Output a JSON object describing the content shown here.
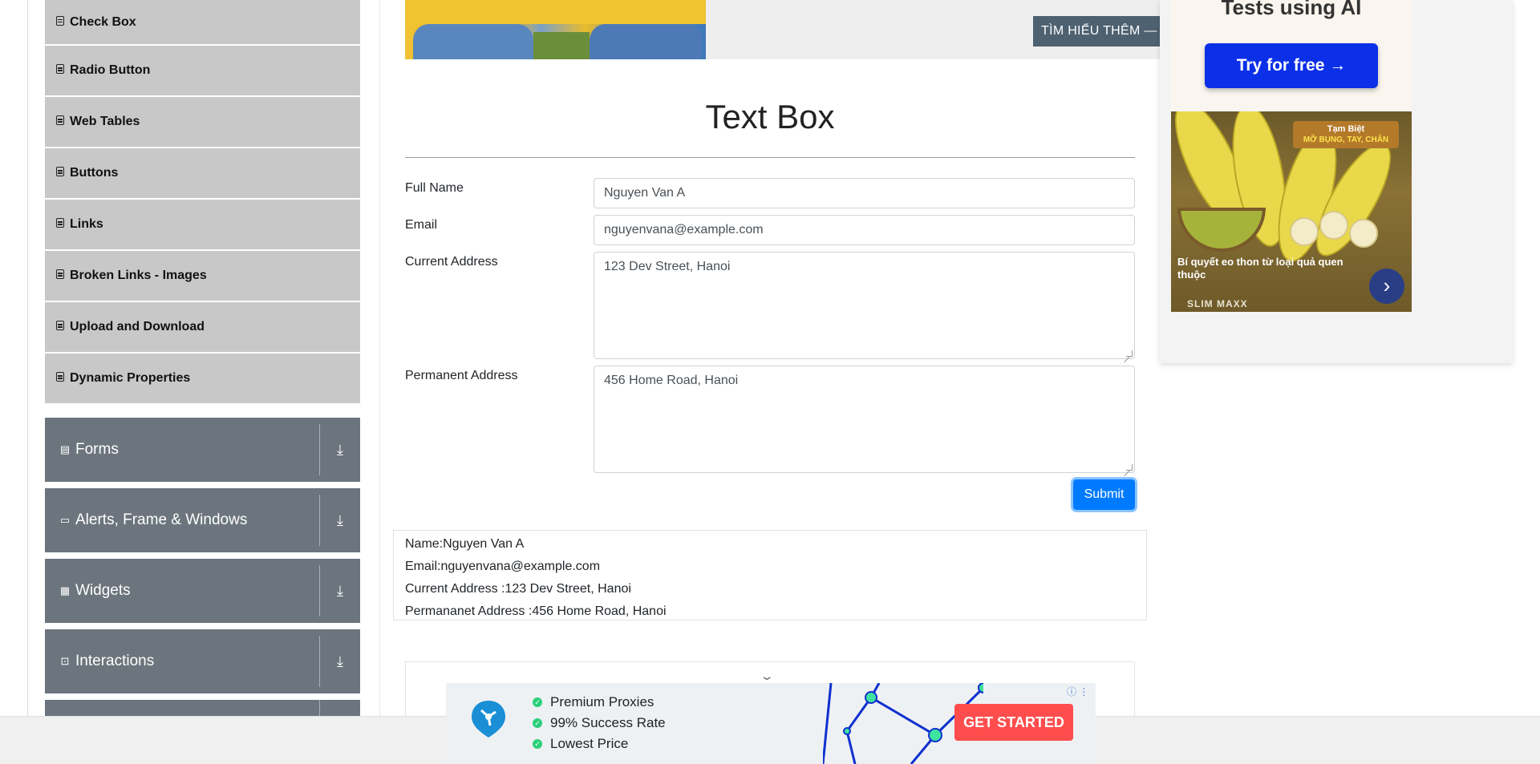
{
  "sidebar": {
    "elements_items": [
      {
        "label": "Check Box"
      },
      {
        "label": "Radio Button"
      },
      {
        "label": "Web Tables"
      },
      {
        "label": "Buttons"
      },
      {
        "label": "Links"
      },
      {
        "label": "Broken Links - Images"
      },
      {
        "label": "Upload and Download"
      },
      {
        "label": "Dynamic Properties"
      }
    ],
    "groups": [
      {
        "label": "Forms",
        "icon": "form-icon"
      },
      {
        "label": "Alerts, Frame & Windows",
        "icon": "window-icon"
      },
      {
        "label": "Widgets",
        "icon": "widgets-icon"
      },
      {
        "label": "Interactions",
        "icon": "interactions-icon"
      }
    ]
  },
  "banner": {
    "cta": "TÌM HIỂU THÊM —"
  },
  "form": {
    "title": "Text Box",
    "full_name_label": "Full Name",
    "full_name_value": "Nguyen Van A",
    "email_label": "Email",
    "email_value": "nguyenvana@example.com",
    "current_address_label": "Current Address",
    "current_address_value": "123 Dev Street, Hanoi",
    "permanent_address_label": "Permanent Address",
    "permanent_address_value": "456 Home Road, Hanoi",
    "submit_label": "Submit"
  },
  "output": {
    "name": "Name:Nguyen Van A",
    "email": "Email:nguyenvana@example.com",
    "current_address": "Current Address :123 Dev Street, Hanoi",
    "permanent_address": "Permananet Address :456 Home Road, Hanoi"
  },
  "right_ad": {
    "headline": "Tests using AI",
    "button": "Try for free →",
    "badge_line1": "Tạm Biệt",
    "badge_line2": "MỠ BỤNG, TAY, CHÂN",
    "caption": "Bí quyết eo thon từ loại quả quen thuộc",
    "brand": "SLIM MAXX"
  },
  "bottom_ad": {
    "features": [
      "Premium Proxies",
      "99% Success Rate",
      "Lowest Price"
    ],
    "cta": "GET STARTED"
  },
  "colors": {
    "group_bg": "#6c757d",
    "submit_bg": "#007bff",
    "sub_item_bg": "#c8c8c8"
  }
}
